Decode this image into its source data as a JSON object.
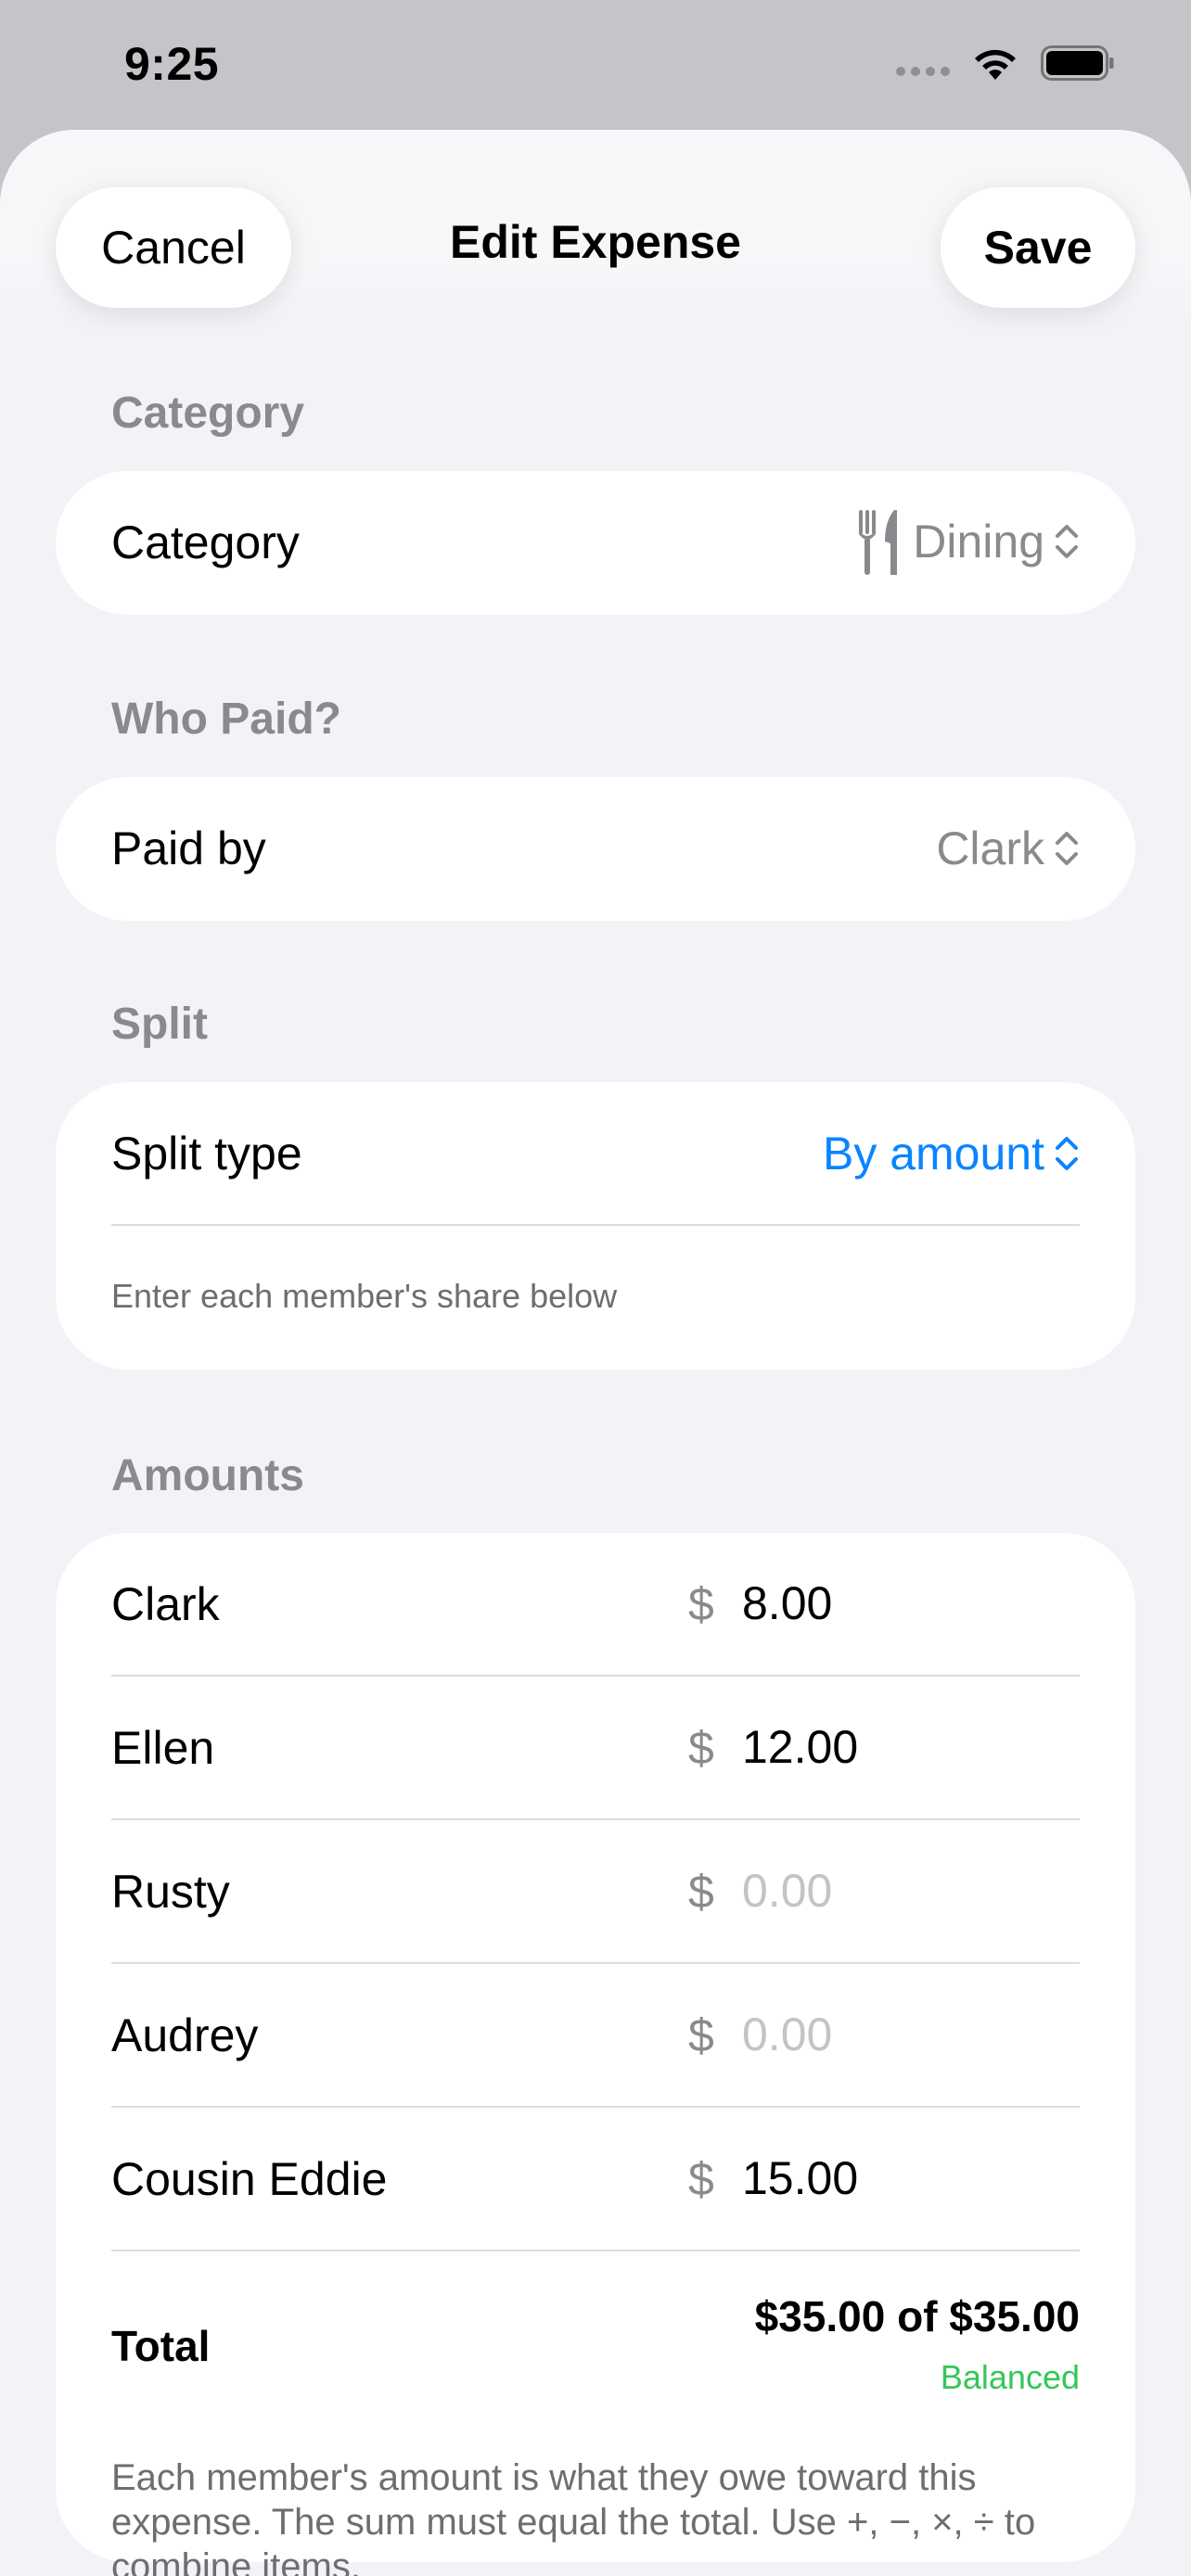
{
  "status_bar": {
    "time": "9:25"
  },
  "nav": {
    "cancel_label": "Cancel",
    "title": "Edit Expense",
    "save_label": "Save"
  },
  "category_section": {
    "header": "Category",
    "row_label": "Category",
    "value": "Dining",
    "icon": "fork-knife-icon"
  },
  "payer_section": {
    "header": "Who Paid?",
    "row_label": "Paid by",
    "value": "Clark"
  },
  "split_section": {
    "header": "Split",
    "row_label": "Split type",
    "value": "By amount",
    "hint": "Enter each member's share below",
    "accent_color": "#0a84ff"
  },
  "amounts_section": {
    "header": "Amounts",
    "currency_symbol": "$",
    "members": [
      {
        "name": "Clark",
        "amount": "8.00",
        "placeholder": "0.00"
      },
      {
        "name": "Ellen",
        "amount": "12.00",
        "placeholder": "0.00"
      },
      {
        "name": "Rusty",
        "amount": "",
        "placeholder": "0.00"
      },
      {
        "name": "Audrey",
        "amount": "",
        "placeholder": "0.00"
      },
      {
        "name": "Cousin Eddie",
        "amount": "15.00",
        "placeholder": "0.00"
      }
    ],
    "total_label": "Total",
    "total_value": "$35.00 of $35.00",
    "status": "Balanced",
    "status_color": "#34c759"
  },
  "footer_note": "Each member's amount is what they owe toward this expense. The sum must equal the total. Use +, −, ×, ÷ to combine items."
}
